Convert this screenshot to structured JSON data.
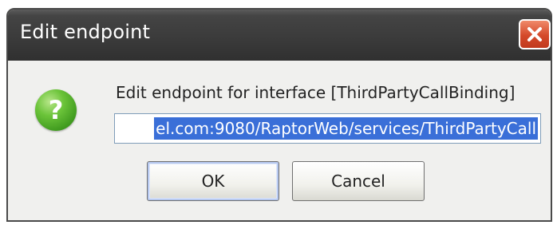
{
  "window": {
    "title": "Edit endpoint",
    "close_icon": "close-icon"
  },
  "dialog": {
    "icon": "question-icon",
    "icon_glyph": "?",
    "message": "Edit endpoint for interface [ThirdPartyCallBinding]",
    "endpoint_value": "el.com:9080/RaptorWeb/services/ThirdPartyCall"
  },
  "buttons": {
    "ok_label": "OK",
    "cancel_label": "Cancel"
  },
  "colors": {
    "titlebar": "#3a3a3a",
    "close_button": "#d4492a",
    "selection": "#3a6fd8",
    "question_icon": "#4fa82a"
  }
}
